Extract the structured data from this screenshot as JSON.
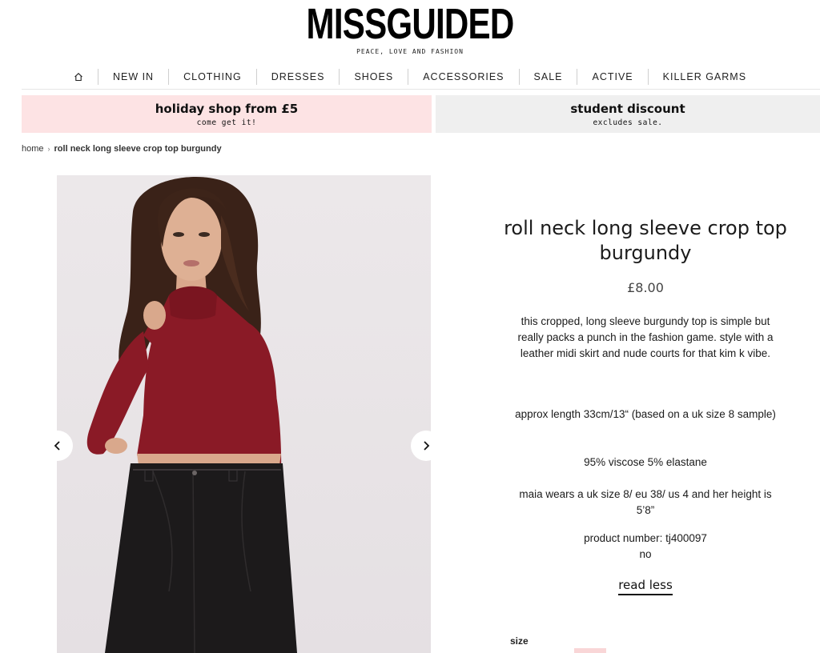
{
  "header": {
    "logo": "MISSGUIDED",
    "tagline": "PEACE, LOVE AND FASHION"
  },
  "nav": {
    "home_icon": "home-icon",
    "items": [
      "NEW IN",
      "CLOTHING",
      "DRESSES",
      "SHOES",
      "ACCESSORIES",
      "SALE",
      "ACTIVE",
      "KILLER GARMS"
    ]
  },
  "promos": [
    {
      "title": "holiday shop from £5",
      "subtitle": "come get it!",
      "background": "#fde3e4"
    },
    {
      "title": "student discount",
      "subtitle": "excludes sale.",
      "background": "#efefef"
    }
  ],
  "breadcrumb": {
    "home": "home",
    "separator": "›",
    "current": "roll neck long sleeve crop top burgundy"
  },
  "gallery": {
    "prev_icon": "chevron-left-icon",
    "next_icon": "chevron-right-icon"
  },
  "product": {
    "title": "roll neck long sleeve crop top burgundy",
    "price": "£8.00",
    "description": "this cropped, long sleeve burgundy top is simple but really packs a punch in the fashion game. style with a leather midi skirt and nude courts for that kim k vibe.",
    "length": "approx length 33cm/13“ (based on a uk size 8 sample)",
    "fabric": "95% viscose 5% elastane",
    "model_info": "maia wears a uk size 8/ eu 38/ us 4 and her height is 5’8”",
    "product_number": "product number: tj400097",
    "extra": "no",
    "read_less": "read less",
    "size_label": "size"
  },
  "colors": {
    "top": "#8a1a26",
    "skirt": "#1c1a1b",
    "promo_pink": "#fde3e4",
    "promo_grey": "#efefef"
  }
}
